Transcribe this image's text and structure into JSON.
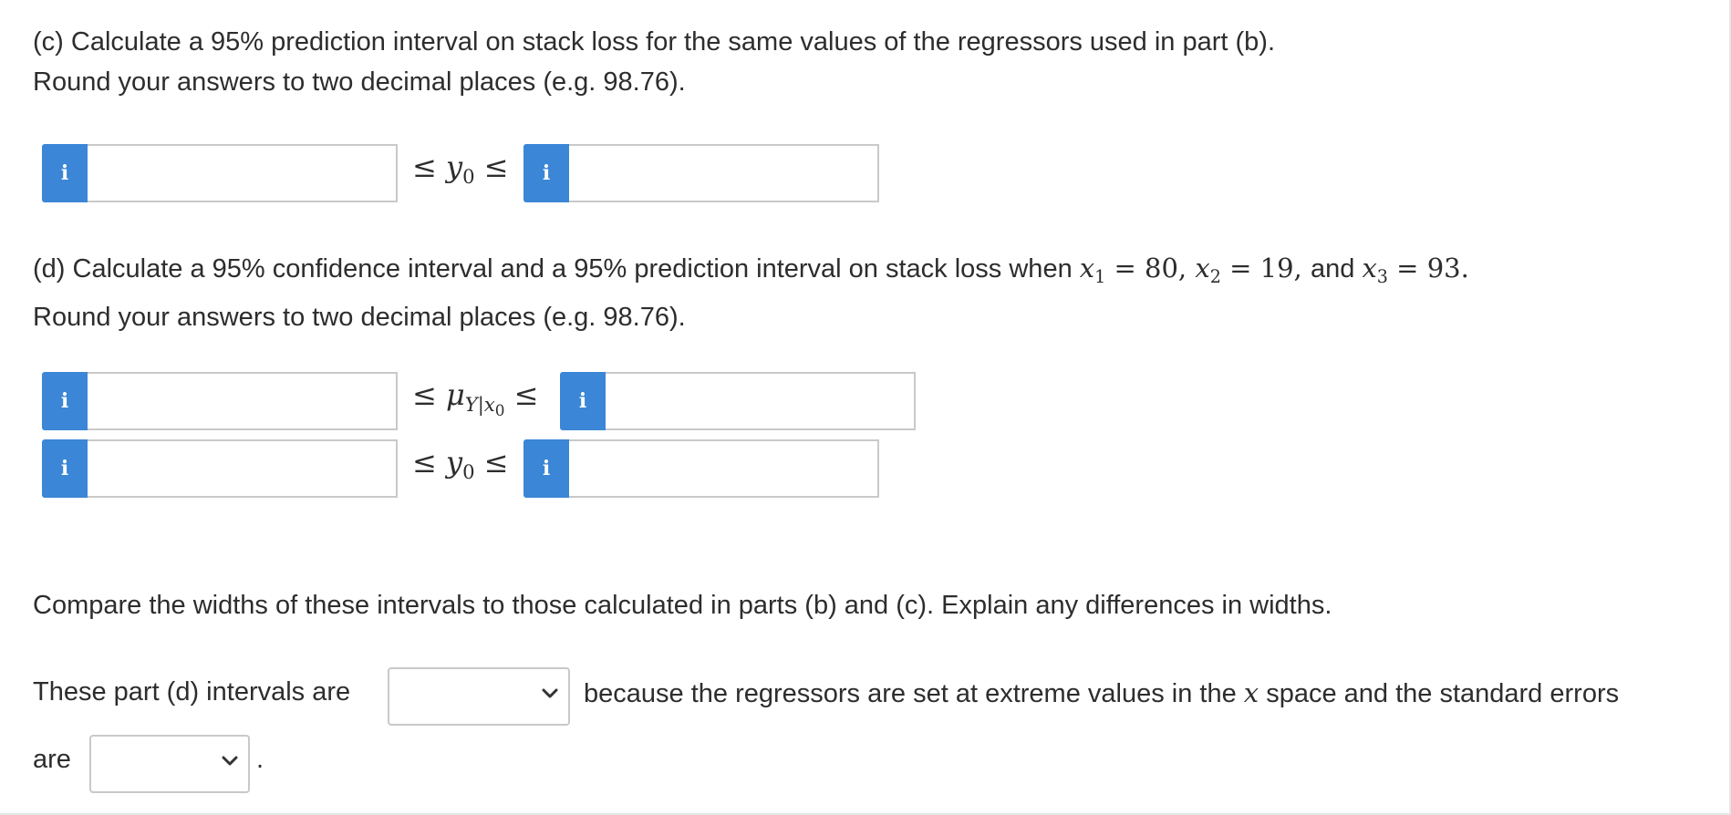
{
  "part_c": {
    "line1": "(c) Calculate a 95% prediction interval on stack loss for the same values of the regressors used in part (b).",
    "line2": "Round your answers to two decimal places (e.g. 98.76).",
    "info_glyph": "i",
    "relation": "≤ y₀ ≤"
  },
  "part_d": {
    "line1_prefix": "(d) Calculate a 95% confidence interval and a 95% prediction interval on stack loss when",
    "line1_x1": "x",
    "line1_x1_sub": "1",
    "line1_eq1": " = 80, ",
    "line1_x2": "x",
    "line1_x2_sub": "2",
    "line1_eq2": " = 19, ",
    "line1_and": "and ",
    "line1_x3": "x",
    "line1_x3_sub": "3",
    "line1_eq3": " = 93.",
    "line2": "Round your answers to two decimal places (e.g. 98.76).",
    "relation_ci": "≤ μY|x₀ ≤",
    "relation_pi": "≤ y₀ ≤"
  },
  "compare": {
    "text": "Compare the widths of these intervals to those calculated in parts (b) and (c). Explain any differences in widths.",
    "sentence_prefix": "These part (d) intervals are",
    "sentence_middle_1": "because the regressors are set at extreme values in the",
    "sentence_x": "x",
    "sentence_middle_2": "space and the standard errors",
    "sentence_are": "are",
    "sentence_end": ".",
    "select1_value": "",
    "select2_value": ""
  }
}
